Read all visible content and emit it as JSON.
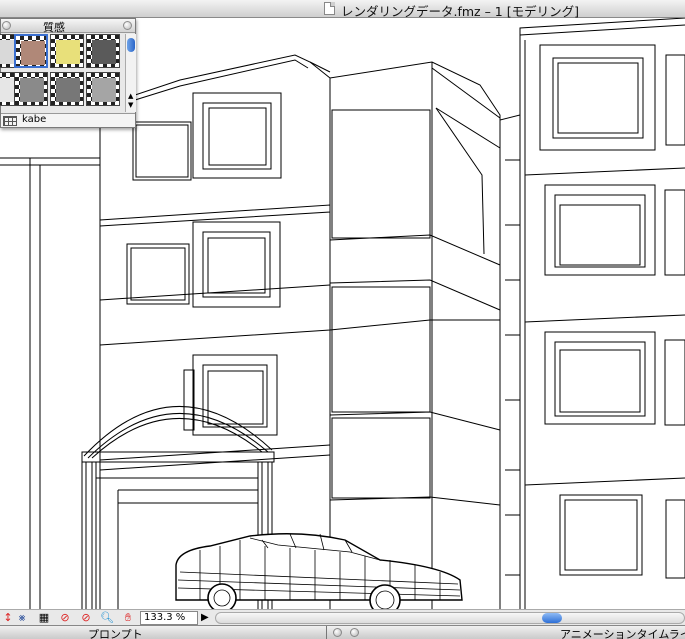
{
  "window": {
    "title": "レンダリングデータ.fmz – 1 [モデリング]"
  },
  "palette": {
    "title": "質感",
    "selected_material": "kabe",
    "swatches": [
      {
        "name": "brown",
        "color": "#b08878"
      },
      {
        "name": "yellow",
        "color": "#e8e07a"
      },
      {
        "name": "dark-gray",
        "color": "#5a5a5a"
      },
      {
        "name": "white",
        "color": "#e6e6e6"
      },
      {
        "name": "gray-texture",
        "color": "#8a8a8a"
      },
      {
        "name": "mid-gray",
        "color": "#777777"
      },
      {
        "name": "light-gray",
        "color": "#a5a5a5"
      }
    ]
  },
  "toolbar": {
    "zoom": "133.3 %"
  },
  "panels": {
    "prompt": "プロンプト",
    "animation": "アニメーションタイムライ"
  }
}
